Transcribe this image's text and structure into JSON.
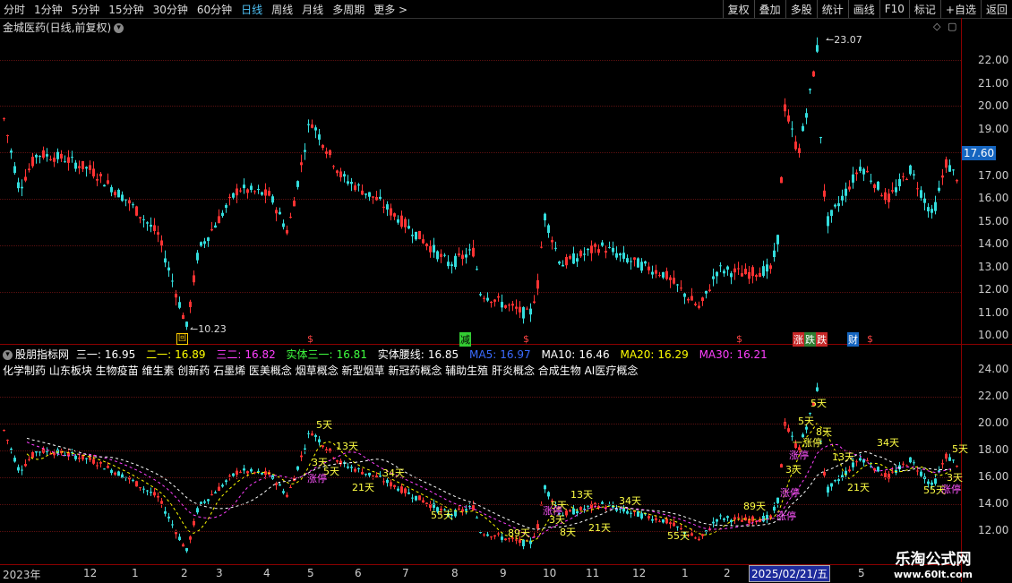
{
  "toolbar": {
    "periods": [
      "分时",
      "1分钟",
      "5分钟",
      "15分钟",
      "30分钟",
      "60分钟",
      "日线",
      "周线",
      "月线",
      "多周期",
      "更多"
    ],
    "active_period": "日线",
    "more_arrow": ">",
    "buttons": [
      "复权",
      "叠加",
      "多股",
      "统计",
      "画线",
      "F10",
      "标记",
      "+自选",
      "返回"
    ]
  },
  "main_panel": {
    "title": "金城医药(日线,前复权)",
    "high_label": "23.07",
    "low_label": "10.23",
    "current_price": "17.60",
    "y_ticks": [
      "22.00",
      "21.00",
      "20.00",
      "19.00",
      "18.00",
      "17.00",
      "16.00",
      "15.00",
      "14.00",
      "13.00",
      "12.00",
      "11.00",
      "10.00"
    ],
    "event_marks": {
      "hui": "回",
      "jian": "减",
      "zhang": "涨",
      "die": "跌",
      "cai": "财",
      "dollar": "$"
    }
  },
  "indicator_panel": {
    "name": "股朋指标网",
    "values": [
      {
        "label": "三一:",
        "value": "16.95",
        "color": "#ffffff"
      },
      {
        "label": "二一:",
        "value": "16.89",
        "color": "#ffff00"
      },
      {
        "label": "三二:",
        "value": "16.82",
        "color": "#ff40ff"
      },
      {
        "label": "实体三一:",
        "value": "16.81",
        "color": "#40ff40"
      },
      {
        "label": "实体腰线:",
        "value": "16.85",
        "color": "#ffffff"
      },
      {
        "label": "MA5:",
        "value": "16.97",
        "color": "#3a6bff"
      },
      {
        "label": "MA10:",
        "value": "16.46",
        "color": "#ffffff"
      },
      {
        "label": "MA20:",
        "value": "16.29",
        "color": "#ffff00"
      },
      {
        "label": "MA30:",
        "value": "16.21",
        "color": "#ff40ff"
      }
    ],
    "concepts": "化学制药 山东板块 生物疫苗 维生素 创新药 石墨烯 医美概念 烟草概念 新型烟草 新冠药概念 辅助生殖 肝炎概念 合成生物 AI医疗概念",
    "y_ticks": [
      "24.00",
      "22.00",
      "20.00",
      "18.00",
      "16.00",
      "14.00",
      "12.00"
    ],
    "annotations": {
      "d5": "5天",
      "d13": "13天",
      "d21": "21天",
      "d34": "34天",
      "d55": "55天",
      "d89": "89天",
      "d3": "3天",
      "d8": "8天",
      "zhangting": "涨停",
      "limit_up_long": "一涨停"
    }
  },
  "x_axis": {
    "labels": [
      "2023年",
      "12",
      "1",
      "2",
      "3",
      "4",
      "5",
      "6",
      "7",
      "8",
      "9",
      "10",
      "11",
      "12",
      "1",
      "2",
      "2025/02/21/五",
      "5"
    ]
  },
  "watermark": {
    "line1": "乐淘公式网",
    "line2": "www.60lt.com"
  },
  "colors": {
    "up": "#ff3333",
    "down": "#33dddd",
    "grid": "#5a1010",
    "axis": "#8b0000",
    "active": "#4fc3f7"
  }
}
